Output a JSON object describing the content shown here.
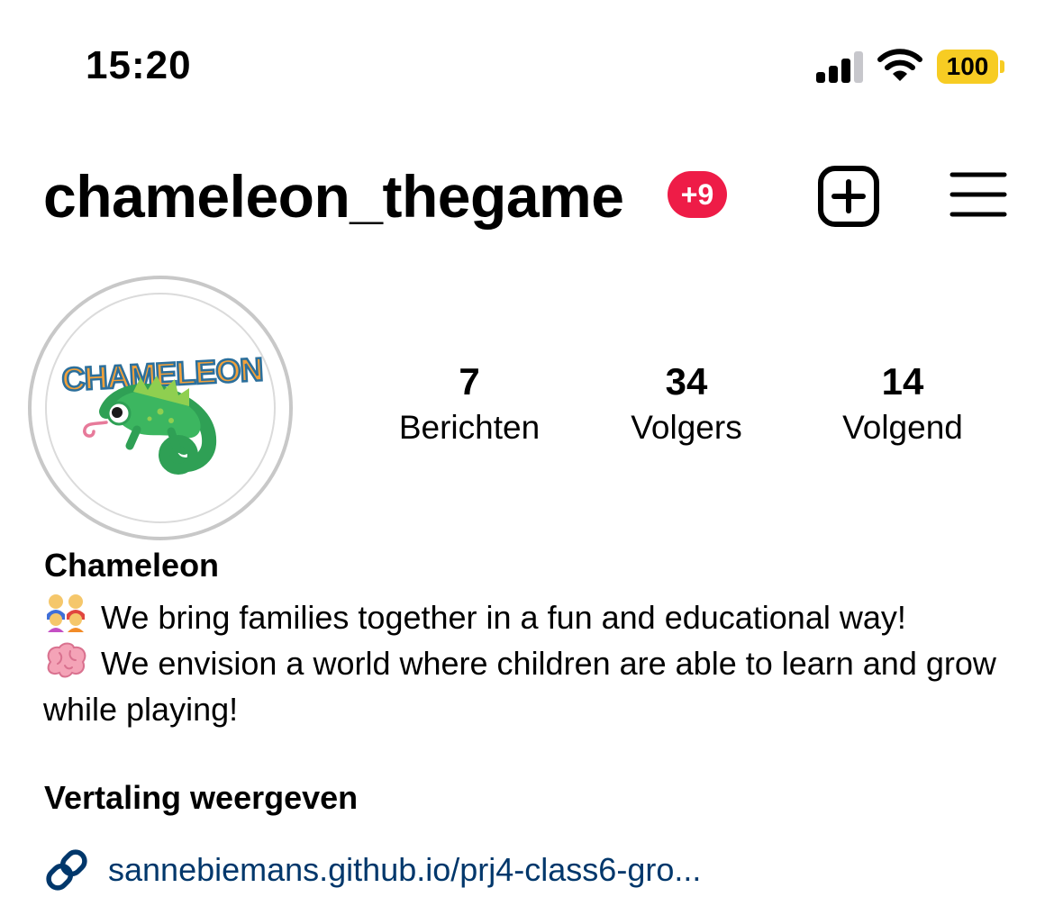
{
  "status_bar": {
    "time": "15:20",
    "battery": "100",
    "signal_icon": "cellular-signal-icon",
    "wifi_icon": "wifi-icon",
    "battery_color": "#f7cc23"
  },
  "header": {
    "username": "chameleon_thegame",
    "notification_badge": "+9",
    "badge_color": "#ee1c47",
    "new_post_icon": "plus-square-icon",
    "menu_icon": "hamburger-menu-icon"
  },
  "profile": {
    "avatar_logo_text": "CHAMELEON",
    "stats": [
      {
        "value": "7",
        "label": "Berichten"
      },
      {
        "value": "34",
        "label": "Volgers"
      },
      {
        "value": "14",
        "label": "Volgend"
      }
    ],
    "display_name": "Chameleon",
    "bio_line1": "We bring families together in a fun and educational way!",
    "bio_line2": "We envision a world where children are able to learn and grow while playing!",
    "translate_label": "Vertaling weergeven",
    "link": "sannebiemans.github.io/prj4-class6-gro...",
    "link_color": "#00376b"
  }
}
